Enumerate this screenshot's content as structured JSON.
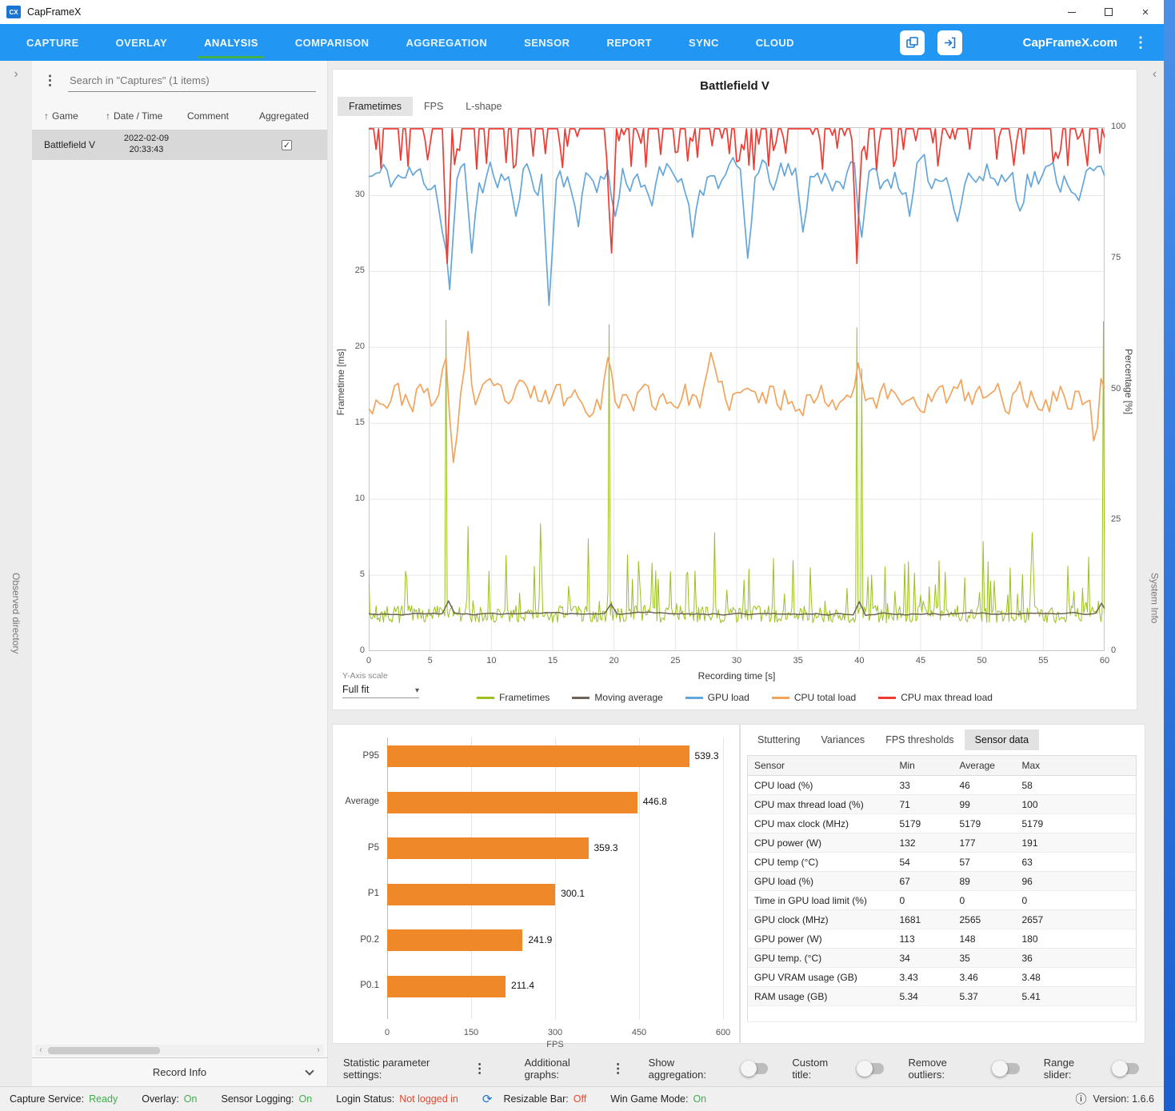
{
  "window": {
    "title": "CapFrameX",
    "icon_text": "CX"
  },
  "nav": {
    "items": [
      {
        "label": "CAPTURE",
        "active": false
      },
      {
        "label": "OVERLAY",
        "active": false
      },
      {
        "label": "ANALYSIS",
        "active": true
      },
      {
        "label": "COMPARISON",
        "active": false
      },
      {
        "label": "AGGREGATION",
        "active": false
      },
      {
        "label": "SENSOR",
        "active": false
      },
      {
        "label": "REPORT",
        "active": false
      },
      {
        "label": "SYNC",
        "active": false
      },
      {
        "label": "CLOUD",
        "active": false
      }
    ],
    "brand": "CapFrameX.com"
  },
  "sidebar": {
    "search_placeholder": "Search in \"Captures\" (1 items)",
    "columns": [
      "Game",
      "Date / Time",
      "Comment",
      "Aggregated"
    ],
    "rows": [
      {
        "game": "Battlefield V",
        "date": "2022-02-09",
        "time": "20:33:43",
        "comment": "",
        "aggregated": true
      }
    ],
    "record_info": "Record Info",
    "observed_directory": "Observed directory"
  },
  "system_info": "System Info",
  "main": {
    "title": "Battlefield V",
    "tabs": [
      "Frametimes",
      "FPS",
      "L-shape"
    ],
    "active_tab": "Frametimes",
    "y_axis_scale_label": "Y-Axis scale",
    "y_axis_scale_value": "Full fit"
  },
  "stats_tabs": [
    "Stuttering",
    "Variances",
    "FPS thresholds",
    "Sensor data"
  ],
  "stats_active_tab": "Sensor data",
  "sensor_table": {
    "columns": [
      "Sensor",
      "Min",
      "Average",
      "Max"
    ],
    "rows": [
      [
        "CPU load (%)",
        "33",
        "46",
        "58"
      ],
      [
        "CPU max thread load (%)",
        "71",
        "99",
        "100"
      ],
      [
        "CPU max clock (MHz)",
        "5179",
        "5179",
        "5179"
      ],
      [
        "CPU power (W)",
        "132",
        "177",
        "191"
      ],
      [
        "CPU temp (°C)",
        "54",
        "57",
        "63"
      ],
      [
        "GPU load (%)",
        "67",
        "89",
        "96"
      ],
      [
        "Time in GPU load limit (%)",
        "0",
        "0",
        "0"
      ],
      [
        "GPU clock (MHz)",
        "1681",
        "2565",
        "2657"
      ],
      [
        "GPU power (W)",
        "113",
        "148",
        "180"
      ],
      [
        "GPU temp. (°C)",
        "34",
        "35",
        "36"
      ],
      [
        "GPU VRAM usage (GB)",
        "3.43",
        "3.46",
        "3.48"
      ],
      [
        "RAM usage (GB)",
        "5.34",
        "5.37",
        "5.41"
      ]
    ]
  },
  "controls": {
    "statistic_parameter_settings": "Statistic parameter settings:",
    "additional_graphs": "Additional graphs:",
    "toggles": [
      {
        "label": "Show aggregation:",
        "on": false
      },
      {
        "label": "Custom title:",
        "on": false
      },
      {
        "label": "Remove outliers:",
        "on": false
      },
      {
        "label": "Range slider:",
        "on": false
      }
    ]
  },
  "status_bar": {
    "items": [
      {
        "label": "Capture Service:",
        "value": "Ready",
        "color": "#3fae49"
      },
      {
        "label": "Overlay:",
        "value": "On",
        "color": "#3fae49"
      },
      {
        "label": "Sensor Logging:",
        "value": "On",
        "color": "#3fae49"
      },
      {
        "label": "Login Status:",
        "value": "Not logged in",
        "color": "#e8482d"
      },
      {
        "label": "Resizable Bar:",
        "value": "Off",
        "color": "#e8482d",
        "icon": "refresh"
      },
      {
        "label": "Win Game Mode:",
        "value": "On",
        "color": "#3fae49"
      }
    ],
    "version": "Version: 1.6.6"
  },
  "chart_data": [
    {
      "type": "line",
      "title": "Battlefield V",
      "xlabel": "Recording time [s]",
      "ylabel_left": "Frametime [ms]",
      "ylabel_right": "Percentage [%]",
      "xlim": [
        0,
        60
      ],
      "ylim_left": [
        0,
        34.5
      ],
      "ylim_right": [
        0,
        100
      ],
      "x_ticks": [
        0,
        5,
        10,
        15,
        20,
        25,
        30,
        35,
        40,
        45,
        50,
        55,
        60
      ],
      "y_left_ticks": [
        0,
        5,
        10,
        15,
        20,
        25,
        30
      ],
      "y_right_ticks": [
        0,
        25,
        50,
        75,
        100
      ],
      "grid": true,
      "legend_position": "bottom",
      "series": [
        {
          "name": "Frametimes",
          "axis": "left",
          "color": "#9bc11e",
          "width": 1,
          "gen": "band",
          "seed": 7,
          "step": 0.1,
          "base": 1.85,
          "band": 1.15,
          "p1": 0.1,
          "a1": 3.6,
          "p2": 0.018,
          "a2": 3.2,
          "v": 0,
          "spikes": [
            [
              6.3,
              21.8
            ],
            [
              8.1,
              8.2
            ],
            [
              11.2,
              6.3
            ],
            [
              14.1,
              5.6
            ],
            [
              17.9,
              7.4
            ],
            [
              19.6,
              21.5
            ],
            [
              23.1,
              5.8
            ],
            [
              26,
              5.2
            ],
            [
              28.2,
              7.8
            ],
            [
              31,
              5.4
            ],
            [
              33,
              6.1
            ],
            [
              36,
              5.5
            ],
            [
              39.8,
              21.3
            ],
            [
              40.2,
              18.6
            ],
            [
              44,
              5.9
            ],
            [
              47,
              5.2
            ],
            [
              50.1,
              7.2
            ],
            [
              54,
              5.4
            ],
            [
              57,
              5.6
            ],
            [
              59.9,
              21.7
            ]
          ]
        },
        {
          "name": "Moving average",
          "axis": "left",
          "color": "#6f6257",
          "width": 1.5,
          "gen": "walk",
          "seed": 3,
          "step": 0.25,
          "base": 2.45,
          "band": 0.35,
          "k": 0.75,
          "clamp": [
            2.1,
            2.95
          ],
          "v": 1,
          "spikes": [
            [
              6.4,
              3.3
            ],
            [
              19.7,
              3.1
            ],
            [
              39.9,
              3.25
            ],
            [
              59.8,
              3.15
            ]
          ]
        },
        {
          "name": "GPU load",
          "axis": "right",
          "color": "#64a6da",
          "width": 1.7,
          "gen": "walk",
          "seed": 11,
          "step": 0.3,
          "base": 90.5,
          "band": 10,
          "k": 0.42,
          "clamp": [
            62,
            96.5
          ],
          "v": 1,
          "spikes": [
            [
              5.9,
              80
            ],
            [
              6.5,
              69
            ],
            [
              8.3,
              76
            ],
            [
              12,
              83
            ],
            [
              14.6,
              66
            ],
            [
              17,
              81
            ],
            [
              20,
              83
            ],
            [
              23,
              85
            ],
            [
              26.5,
              79
            ],
            [
              31,
              75
            ],
            [
              35.5,
              80
            ],
            [
              40.2,
              79
            ],
            [
              44,
              83
            ],
            [
              48,
              82
            ],
            [
              53,
              84
            ],
            [
              58,
              86
            ]
          ]
        },
        {
          "name": "CPU total load",
          "axis": "right",
          "color": "#f2a45c",
          "width": 1.7,
          "gen": "walk",
          "seed": 23,
          "step": 0.3,
          "base": 48.5,
          "band": 9,
          "k": 0.4,
          "clamp": [
            33,
            61
          ],
          "v": 1,
          "spikes": [
            [
              6.2,
              56
            ],
            [
              7,
              36
            ],
            [
              8,
              61
            ],
            [
              8.6,
              47
            ],
            [
              19.6,
              56
            ],
            [
              28,
              57
            ],
            [
              39.9,
              55
            ],
            [
              59.3,
              33
            ],
            [
              59.8,
              52
            ]
          ]
        },
        {
          "name": "CPU max thread load",
          "axis": "right",
          "color": "#ee3b33",
          "width": 1.7,
          "gen": "ceiling",
          "seed": 31,
          "step": 0.2,
          "base": 99.7,
          "p1": 0.3,
          "a1": 7,
          "clamp": [
            70,
            100
          ],
          "v": 1,
          "spikes": [
            [
              6.4,
              74
            ],
            [
              19.8,
              76
            ],
            [
              39.9,
              74
            ]
          ]
        }
      ]
    },
    {
      "type": "bar",
      "orientation": "horizontal",
      "categories": [
        "P95",
        "Average",
        "P5",
        "P1",
        "P0.2",
        "P0.1"
      ],
      "values": [
        539.3,
        446.8,
        359.3,
        300.1,
        241.9,
        211.4
      ],
      "xlabel": "FPS",
      "x_ticks": [
        0,
        150,
        300,
        450,
        600
      ],
      "xlim": [
        0,
        600
      ],
      "bar_color": "#ef8829"
    }
  ]
}
